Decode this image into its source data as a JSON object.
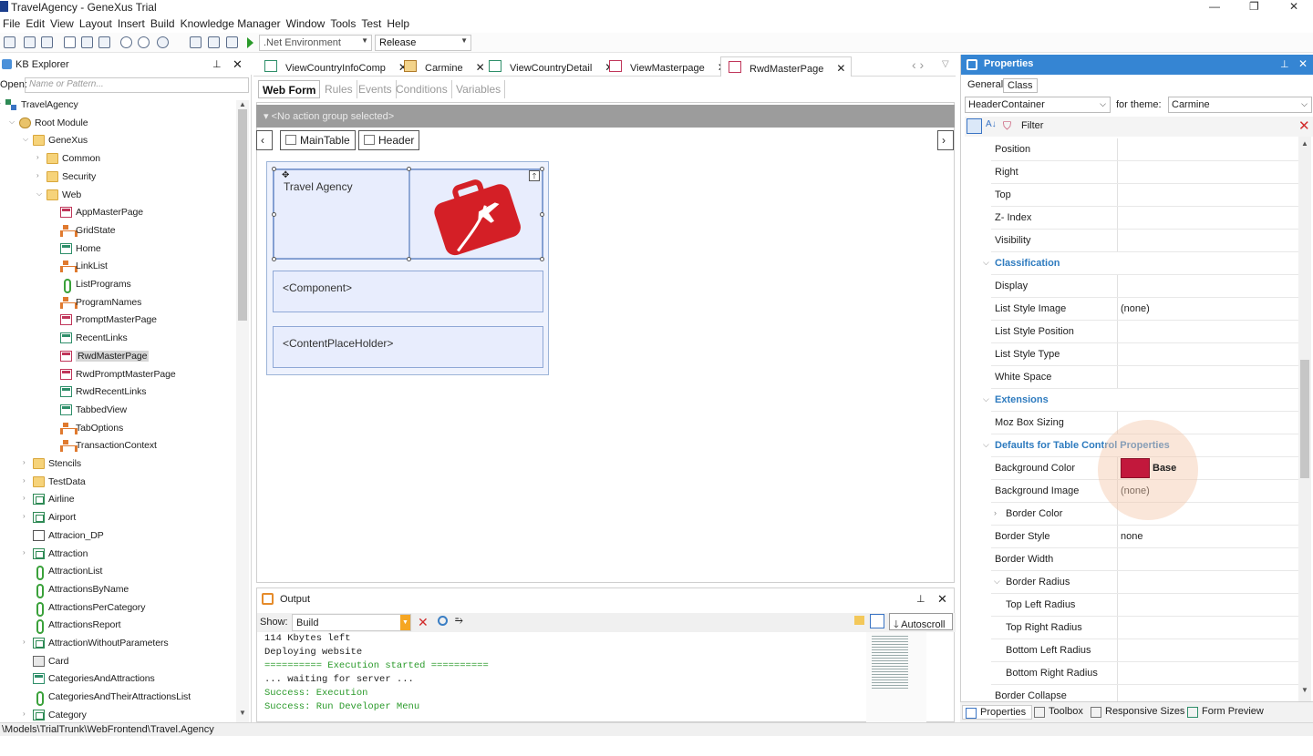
{
  "window": {
    "title": "TravelAgency - GeneXus Trial",
    "controls": [
      "—",
      "❐",
      "✕"
    ]
  },
  "menu": [
    "File",
    "Edit",
    "View",
    "Layout",
    "Insert",
    "Build",
    "Knowledge Manager",
    "Window",
    "Tools",
    "Test",
    "Help"
  ],
  "toolbar": {
    "environment": ".Net Environment",
    "configuration": "Release"
  },
  "kb_explorer": {
    "title": "KB Explorer",
    "open_label": "Open:",
    "open_placeholder": "Name or Pattern...",
    "tree": [
      {
        "label": "TravelAgency",
        "depth": 0,
        "icon": "kb",
        "expanded": true
      },
      {
        "label": "Root Module",
        "depth": 1,
        "icon": "root",
        "expanded": true
      },
      {
        "label": "GeneXus",
        "depth": 2,
        "icon": "folder",
        "expanded": true
      },
      {
        "label": "Common",
        "depth": 3,
        "icon": "folder",
        "expanded": false
      },
      {
        "label": "Security",
        "depth": 3,
        "icon": "folder",
        "expanded": false
      },
      {
        "label": "Web",
        "depth": 3,
        "icon": "folder",
        "expanded": true
      },
      {
        "label": "AppMasterPage",
        "depth": 4,
        "icon": "form"
      },
      {
        "label": "GridState",
        "depth": 4,
        "icon": "proc"
      },
      {
        "label": "Home",
        "depth": 4,
        "icon": "grid"
      },
      {
        "label": "LinkList",
        "depth": 4,
        "icon": "proc"
      },
      {
        "label": "ListPrograms",
        "depth": 4,
        "icon": "pgm"
      },
      {
        "label": "ProgramNames",
        "depth": 4,
        "icon": "proc"
      },
      {
        "label": "PromptMasterPage",
        "depth": 4,
        "icon": "form"
      },
      {
        "label": "RecentLinks",
        "depth": 4,
        "icon": "grid"
      },
      {
        "label": "RwdMasterPage",
        "depth": 4,
        "icon": "form",
        "selected": true
      },
      {
        "label": "RwdPromptMasterPage",
        "depth": 4,
        "icon": "form"
      },
      {
        "label": "RwdRecentLinks",
        "depth": 4,
        "icon": "grid"
      },
      {
        "label": "TabbedView",
        "depth": 4,
        "icon": "grid"
      },
      {
        "label": "TabOptions",
        "depth": 4,
        "icon": "proc"
      },
      {
        "label": "TransactionContext",
        "depth": 4,
        "icon": "proc"
      },
      {
        "label": "Stencils",
        "depth": 2,
        "icon": "folder",
        "expanded": false
      },
      {
        "label": "TestData",
        "depth": 2,
        "icon": "folder",
        "expanded": false
      },
      {
        "label": "Airline",
        "depth": 2,
        "icon": "trn",
        "expanded": false
      },
      {
        "label": "Airport",
        "depth": 2,
        "icon": "trn",
        "expanded": false
      },
      {
        "label": "Attracion_DP",
        "depth": 2,
        "icon": "dp"
      },
      {
        "label": "Attraction",
        "depth": 2,
        "icon": "trn",
        "expanded": false
      },
      {
        "label": "AttractionList",
        "depth": 2,
        "icon": "pgm"
      },
      {
        "label": "AttractionsByName",
        "depth": 2,
        "icon": "pgm"
      },
      {
        "label": "AttractionsPerCategory",
        "depth": 2,
        "icon": "pgm"
      },
      {
        "label": "AttractionsReport",
        "depth": 2,
        "icon": "pgm"
      },
      {
        "label": "AttractionWithoutParameters",
        "depth": 2,
        "icon": "trn",
        "expanded": false
      },
      {
        "label": "Card",
        "depth": 2,
        "icon": "card"
      },
      {
        "label": "CategoriesAndAttractions",
        "depth": 2,
        "icon": "grid"
      },
      {
        "label": "CategoriesAndTheirAttractionsList",
        "depth": 2,
        "icon": "pgm"
      },
      {
        "label": "Category",
        "depth": 2,
        "icon": "trn",
        "expanded": false
      }
    ]
  },
  "doc_tabs": [
    {
      "label": "ViewCountryInfoComp",
      "icon": "grid"
    },
    {
      "label": "Carmine",
      "icon": "theme"
    },
    {
      "label": "ViewCountryDetail",
      "icon": "grid"
    },
    {
      "label": "ViewMasterpage",
      "icon": "form"
    },
    {
      "label": "RwdMasterPage",
      "icon": "form",
      "active": true
    }
  ],
  "editor_tabs": [
    "Web Form",
    "Rules",
    "Events",
    "Conditions",
    "Variables"
  ],
  "designer": {
    "action_group": "<No action group selected>",
    "breadcrumb": [
      "MainTable",
      "Header"
    ],
    "header_text": "Travel Agency",
    "component": "<Component>",
    "placeholder": "<ContentPlaceHolder>"
  },
  "output": {
    "title": "Output",
    "show_label": "Show:",
    "show_value": "Build",
    "autoscroll": "Autoscroll",
    "lines": [
      {
        "text": "114 Kbytes left",
        "color": "#1e1e1e"
      },
      {
        "text": "Deploying website",
        "color": "#1e1e1e"
      },
      {
        "text": "========== Execution started ==========",
        "color": "#2a9a2a"
      },
      {
        "text": "... waiting for server ...",
        "color": "#1e1e1e"
      },
      {
        "text": "Success: Execution",
        "color": "#2a9a2a"
      },
      {
        "text": "Success: Run Developer Menu",
        "color": "#2a9a2a"
      }
    ]
  },
  "properties": {
    "title": "Properties",
    "tabs": [
      "General",
      "Class"
    ],
    "class_value": "HeaderContainer",
    "theme_label": "for theme:",
    "theme_value": "Carmine",
    "filter_label": "Filter",
    "rows": [
      {
        "k": "Position",
        "v": "",
        "type": "prop",
        "indent": 0
      },
      {
        "k": "Right",
        "v": "",
        "type": "prop",
        "indent": 0
      },
      {
        "k": "Top",
        "v": "",
        "type": "prop",
        "indent": 0
      },
      {
        "k": "Z- Index",
        "v": "",
        "type": "prop",
        "indent": 0
      },
      {
        "k": "Visibility",
        "v": "",
        "type": "prop",
        "indent": 0
      },
      {
        "k": "Classification",
        "v": "",
        "type": "cat",
        "indent": 0
      },
      {
        "k": "Display",
        "v": "",
        "type": "prop",
        "indent": 0
      },
      {
        "k": "List Style Image",
        "v": "(none)",
        "type": "prop",
        "indent": 0
      },
      {
        "k": "List Style Position",
        "v": "",
        "type": "prop",
        "indent": 0
      },
      {
        "k": "List Style Type",
        "v": "",
        "type": "prop",
        "indent": 0
      },
      {
        "k": "White Space",
        "v": "",
        "type": "prop",
        "indent": 0
      },
      {
        "k": "Extensions",
        "v": "",
        "type": "cat",
        "indent": 0
      },
      {
        "k": "Moz Box Sizing",
        "v": "",
        "type": "prop",
        "indent": 0
      },
      {
        "k": "Defaults for Table Control Properties",
        "v": "",
        "type": "cat",
        "indent": 0
      },
      {
        "k": "Background Color",
        "v": "Base",
        "type": "color",
        "indent": 0
      },
      {
        "k": "Background Image",
        "v": "(none)",
        "type": "prop",
        "indent": 0
      },
      {
        "k": "Border Color",
        "v": "",
        "type": "group",
        "indent": 1
      },
      {
        "k": "Border Style",
        "v": "none",
        "type": "prop",
        "indent": 0
      },
      {
        "k": "Border Width",
        "v": "",
        "type": "prop",
        "indent": 0
      },
      {
        "k": "Border Radius",
        "v": "",
        "type": "groupopen",
        "indent": 1
      },
      {
        "k": "Top Left Radius",
        "v": "",
        "type": "prop",
        "indent": 1
      },
      {
        "k": "Top Right Radius",
        "v": "",
        "type": "prop",
        "indent": 1
      },
      {
        "k": "Bottom Left Radius",
        "v": "",
        "type": "prop",
        "indent": 1
      },
      {
        "k": "Bottom Right Radius",
        "v": "",
        "type": "prop",
        "indent": 1
      },
      {
        "k": "Border Collapse",
        "v": "",
        "type": "prop",
        "indent": 0
      }
    ],
    "bottom_tabs": [
      "Properties",
      "Toolbox",
      "Responsive Sizes",
      "Form Preview"
    ]
  },
  "status_bar": "\\Models\\TrialTrunk\\WebFrontend\\Travel.Agency",
  "colors": {
    "accent": "#3585d3",
    "swatch": "#c2183c",
    "logo": "#d41f26"
  }
}
